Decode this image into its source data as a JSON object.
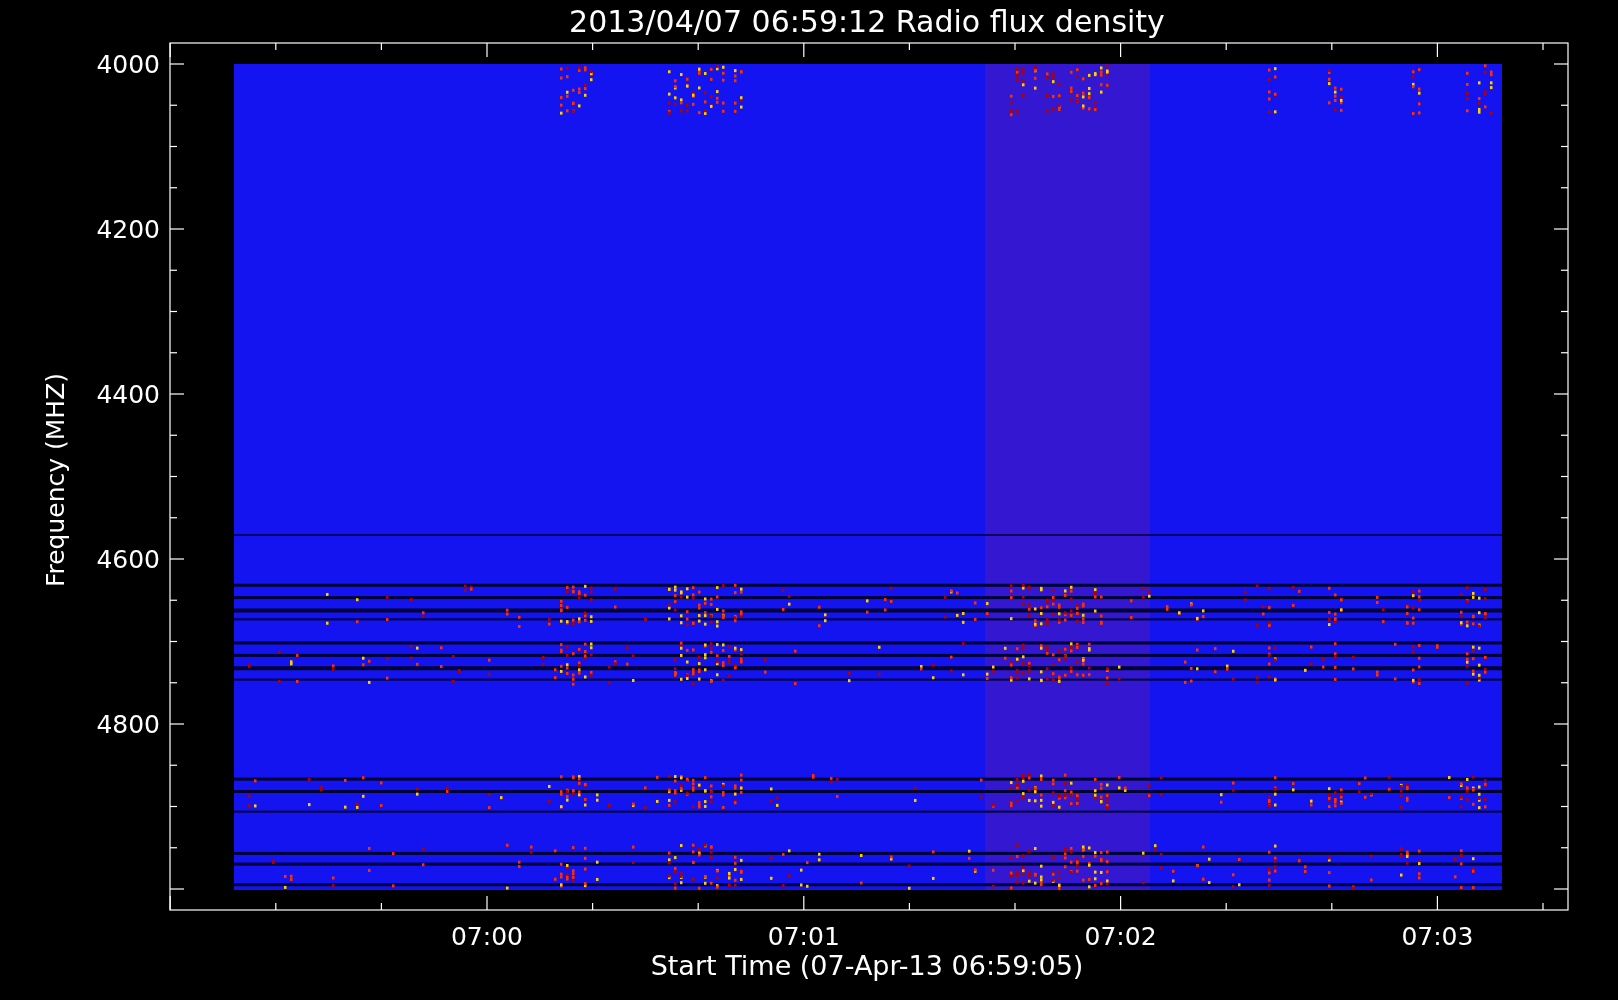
{
  "plot": {
    "title": "2013/04/07 06:59:12 Radio flux density",
    "ylabel": "Frequency (MHZ)",
    "xlabel": "Start Time (07-Apr-13 06:59:05)",
    "yticks": [
      "4000",
      "4200",
      "4400",
      "4600",
      "4800"
    ],
    "xticks": [
      "07:00",
      "07:01",
      "07:02",
      "07:03"
    ]
  }
}
